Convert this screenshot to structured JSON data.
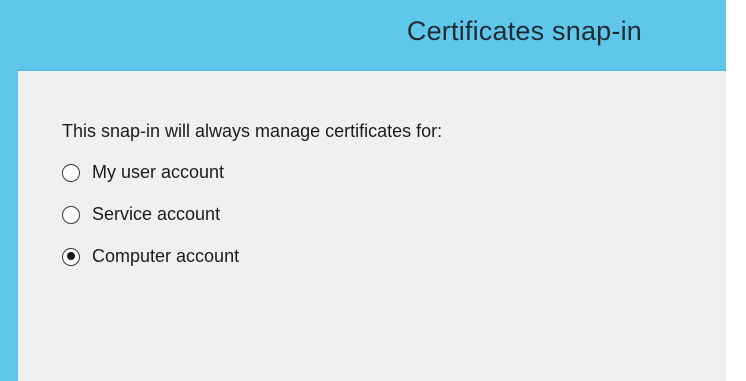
{
  "dialog": {
    "title": "Certificates snap-in",
    "prompt": "This snap-in will always manage certificates for:",
    "options": [
      {
        "label": "My user account",
        "selected": false
      },
      {
        "label": "Service account",
        "selected": false
      },
      {
        "label": "Computer account",
        "selected": true
      }
    ]
  },
  "colors": {
    "accent": "#5fc7ea",
    "content_background": "#f0f0f0",
    "text": "#1b1b1b"
  }
}
